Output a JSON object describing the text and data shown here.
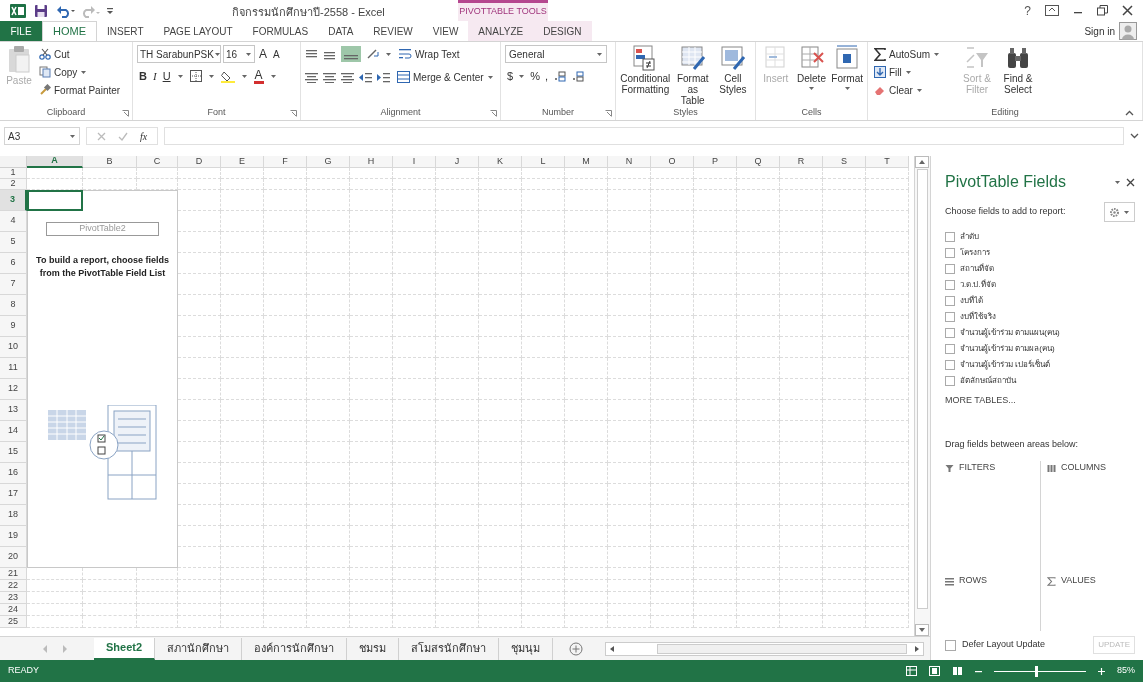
{
  "window": {
    "title": "กิจกรรมนักศึกษาปี-2558 - Excel",
    "help": "?",
    "contextual_group": "PIVOTTABLE TOOLS",
    "sign_in": "Sign in"
  },
  "tabs": [
    {
      "label": "FILE",
      "kind": "file",
      "selected": false
    },
    {
      "label": "HOME",
      "kind": "normal",
      "selected": true
    },
    {
      "label": "INSERT",
      "kind": "normal",
      "selected": false
    },
    {
      "label": "PAGE LAYOUT",
      "kind": "normal",
      "selected": false
    },
    {
      "label": "FORMULAS",
      "kind": "normal",
      "selected": false
    },
    {
      "label": "DATA",
      "kind": "normal",
      "selected": false
    },
    {
      "label": "REVIEW",
      "kind": "normal",
      "selected": false
    },
    {
      "label": "VIEW",
      "kind": "normal",
      "selected": false
    },
    {
      "label": "ANALYZE",
      "kind": "contextual",
      "selected": false
    },
    {
      "label": "DESIGN",
      "kind": "contextual",
      "selected": false
    }
  ],
  "ribbon": {
    "clipboard": {
      "label": "Clipboard",
      "paste": {
        "label": "Paste",
        "disabled": true
      },
      "cut": "Cut",
      "copy": "Copy",
      "format_painter": "Format Painter"
    },
    "font": {
      "label": "Font",
      "font_name": "TH SarabunPSK",
      "font_size": "16",
      "grow": "A",
      "shrink": "A",
      "bold": "B",
      "italic": "I",
      "underline": "U",
      "font_color": "A"
    },
    "alignment": {
      "label": "Alignment",
      "wrap_text": "Wrap Text",
      "merge_center": "Merge & Center"
    },
    "number": {
      "label": "Number",
      "format": "General",
      "currency": "$",
      "percent": "%",
      "comma": ","
    },
    "styles": {
      "label": "Styles",
      "buttons": [
        {
          "label": "Conditional Formatting"
        },
        {
          "label": "Format as Table"
        },
        {
          "label": "Cell Styles"
        }
      ]
    },
    "cells": {
      "label": "Cells",
      "buttons": [
        {
          "label": "Insert",
          "disabled": true
        },
        {
          "label": "Delete",
          "disabled": false
        },
        {
          "label": "Format",
          "disabled": false
        }
      ]
    },
    "editing": {
      "label": "Editing",
      "autosum": "AutoSum",
      "fill": "Fill",
      "clear": "Clear",
      "sort_filter": {
        "label": "Sort & Filter",
        "disabled": true
      },
      "find_select": {
        "label": "Find & Select",
        "disabled": false
      }
    }
  },
  "formula_bar": {
    "name_box": "A3",
    "function_label": "fx"
  },
  "columns": [
    {
      "label": "A",
      "selected": true
    },
    {
      "label": "B",
      "selected": false
    },
    {
      "label": "C",
      "selected": false
    },
    {
      "label": "D",
      "selected": false
    },
    {
      "label": "E",
      "selected": false
    },
    {
      "label": "F",
      "selected": false
    },
    {
      "label": "G",
      "selected": false
    },
    {
      "label": "H",
      "selected": false
    },
    {
      "label": "I",
      "selected": false
    },
    {
      "label": "J",
      "selected": false
    },
    {
      "label": "K",
      "selected": false
    },
    {
      "label": "L",
      "selected": false
    },
    {
      "label": "M",
      "selected": false
    },
    {
      "label": "N",
      "selected": false
    },
    {
      "label": "O",
      "selected": false
    },
    {
      "label": "P",
      "selected": false
    },
    {
      "label": "Q",
      "selected": false
    },
    {
      "label": "R",
      "selected": false
    },
    {
      "label": "S",
      "selected": false
    },
    {
      "label": "T",
      "selected": false
    }
  ],
  "rows": [
    {
      "label": "1",
      "selected": false
    },
    {
      "label": "2",
      "selected": false
    },
    {
      "label": "3",
      "selected": true
    },
    {
      "label": "4",
      "selected": false
    },
    {
      "label": "5",
      "selected": false
    },
    {
      "label": "6",
      "selected": false
    },
    {
      "label": "7",
      "selected": false
    },
    {
      "label": "8",
      "selected": false
    },
    {
      "label": "9",
      "selected": false
    },
    {
      "label": "10",
      "selected": false
    },
    {
      "label": "11",
      "selected": false
    },
    {
      "label": "12",
      "selected": false
    },
    {
      "label": "13",
      "selected": false
    },
    {
      "label": "14",
      "selected": false
    },
    {
      "label": "15",
      "selected": false
    },
    {
      "label": "16",
      "selected": false
    },
    {
      "label": "17",
      "selected": false
    },
    {
      "label": "18",
      "selected": false
    },
    {
      "label": "19",
      "selected": false
    },
    {
      "label": "20",
      "selected": false
    },
    {
      "label": "21",
      "selected": false
    },
    {
      "label": "22",
      "selected": false
    },
    {
      "label": "23",
      "selected": false
    },
    {
      "label": "24",
      "selected": false
    },
    {
      "label": "25",
      "selected": false
    }
  ],
  "pivot_placeholder": {
    "name": "PivotTable2",
    "message": "To build a report, choose fields from the PivotTable Field List"
  },
  "sheet_tabs": [
    {
      "label": "Sheet2",
      "selected": true
    },
    {
      "label": "สภานักศึกษา",
      "selected": false
    },
    {
      "label": "องค์การนักศึกษา",
      "selected": false
    },
    {
      "label": "ชมรม",
      "selected": false
    },
    {
      "label": "สโมสรนักศึกษา",
      "selected": false
    },
    {
      "label": "ชุมนุม",
      "selected": false
    }
  ],
  "status_bar": {
    "status": "READY",
    "zoom_slider": {
      "level": 0.45
    },
    "zoom": "85%"
  },
  "pivot_pane": {
    "title": "PivotTable Fields",
    "choose_label": "Choose fields to add to report:",
    "fields": [
      {
        "label": "ลำดับ",
        "checked": false
      },
      {
        "label": "โครงการ",
        "checked": false
      },
      {
        "label": "สถานที่จัด",
        "checked": false
      },
      {
        "label": "ว.ด.ป.ที่จัด",
        "checked": false
      },
      {
        "label": "งบที่ได้",
        "checked": false
      },
      {
        "label": "งบที่ใช้จริง",
        "checked": false
      },
      {
        "label": "จำนวนผู้เข้าร่วม ตามแผน(คน)",
        "checked": false
      },
      {
        "label": "จำนวนผู้เข้าร่วม ตามผล(คน)",
        "checked": false
      },
      {
        "label": "จำนวนผู้เข้าร่วม เปอร์เซ็นต์",
        "checked": false
      },
      {
        "label": "อัตลักษณ์สถาบัน",
        "checked": false
      }
    ],
    "more_tables": "MORE TABLES...",
    "drag_label": "Drag fields between areas below:",
    "areas": [
      {
        "kind": "filters",
        "label": "FILTERS"
      },
      {
        "kind": "columns",
        "label": "COLUMNS"
      },
      {
        "kind": "rows",
        "label": "ROWS"
      },
      {
        "kind": "values",
        "label": "VALUES"
      }
    ],
    "defer": {
      "label": "Defer Layout Update",
      "checked": false
    },
    "update_button": {
      "label": "UPDATE",
      "disabled": true
    }
  }
}
